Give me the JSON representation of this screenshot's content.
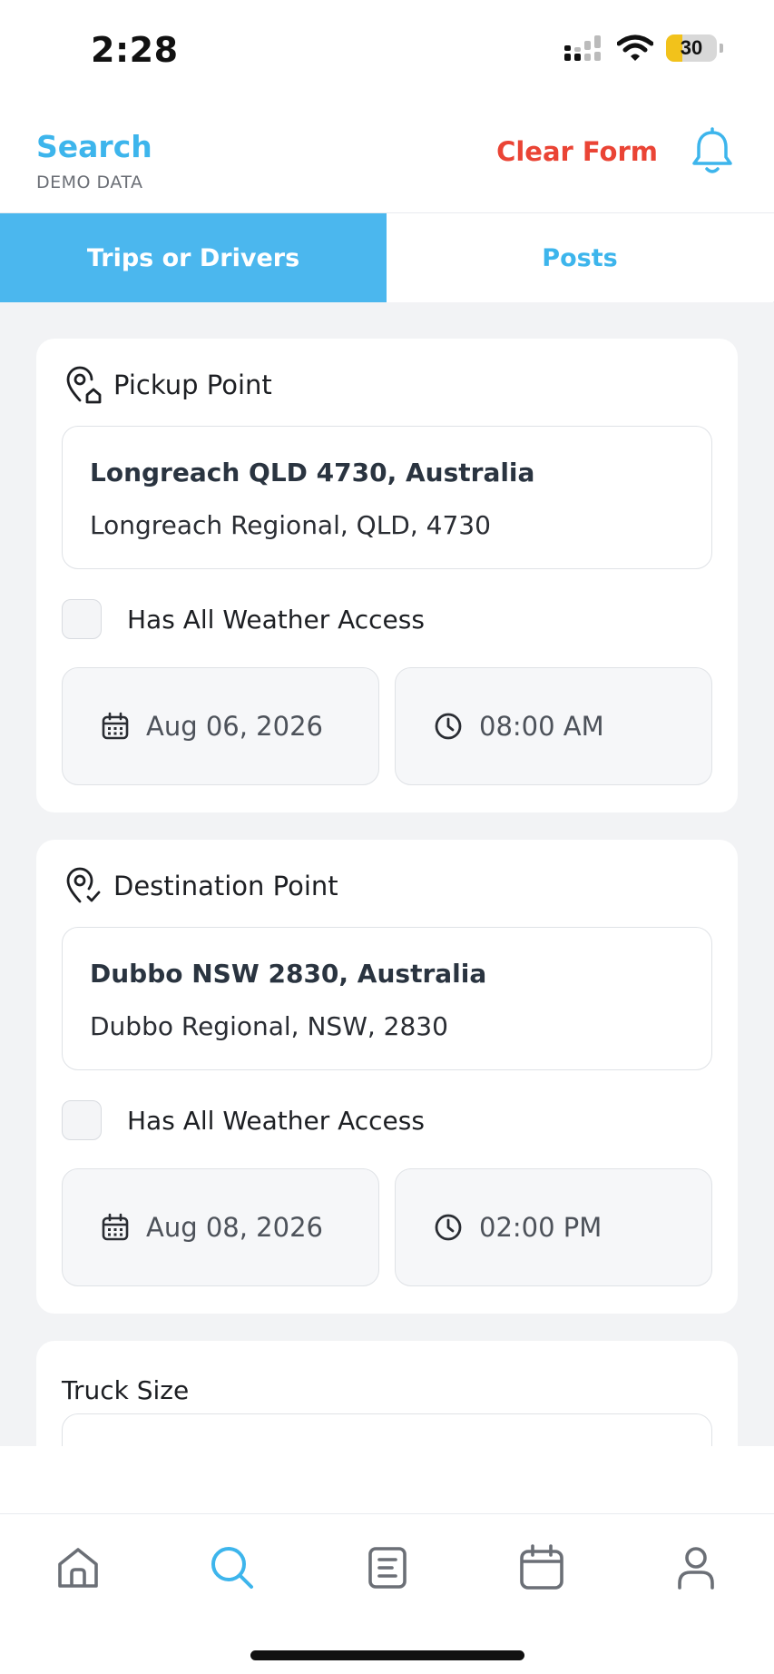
{
  "status_bar": {
    "time": "2:28",
    "battery": "30"
  },
  "header": {
    "title": "Search",
    "subtitle": "DEMO DATA",
    "clear_label": "Clear Form"
  },
  "tabs": [
    {
      "label": "Trips or Drivers",
      "active": true
    },
    {
      "label": "Posts",
      "active": false
    }
  ],
  "pickup": {
    "title": "Pickup Point",
    "address_main": "Longreach QLD 4730, Australia",
    "address_sub": "Longreach Regional, QLD, 4730",
    "weather_label": "Has All Weather Access",
    "weather_checked": false,
    "date": "Aug 06, 2026",
    "time": "08:00 AM"
  },
  "destination": {
    "title": "Destination Point",
    "address_main": "Dubbo NSW 2830, Australia",
    "address_sub": "Dubbo Regional, NSW, 2830",
    "weather_label": "Has All Weather Access",
    "weather_checked": false,
    "date": "Aug 08, 2026",
    "time": "02:00 PM"
  },
  "truck": {
    "label": "Truck Size"
  },
  "bottom_nav": [
    {
      "icon": "home-icon",
      "active": false
    },
    {
      "icon": "search-icon",
      "active": true
    },
    {
      "icon": "posts-icon",
      "active": false
    },
    {
      "icon": "calendar-icon",
      "active": false
    },
    {
      "icon": "profile-icon",
      "active": false
    }
  ],
  "colors": {
    "accent": "#3db5ec",
    "tab_active": "#4bb7ee",
    "danger": "#ea4435",
    "background": "#f2f3f5"
  }
}
